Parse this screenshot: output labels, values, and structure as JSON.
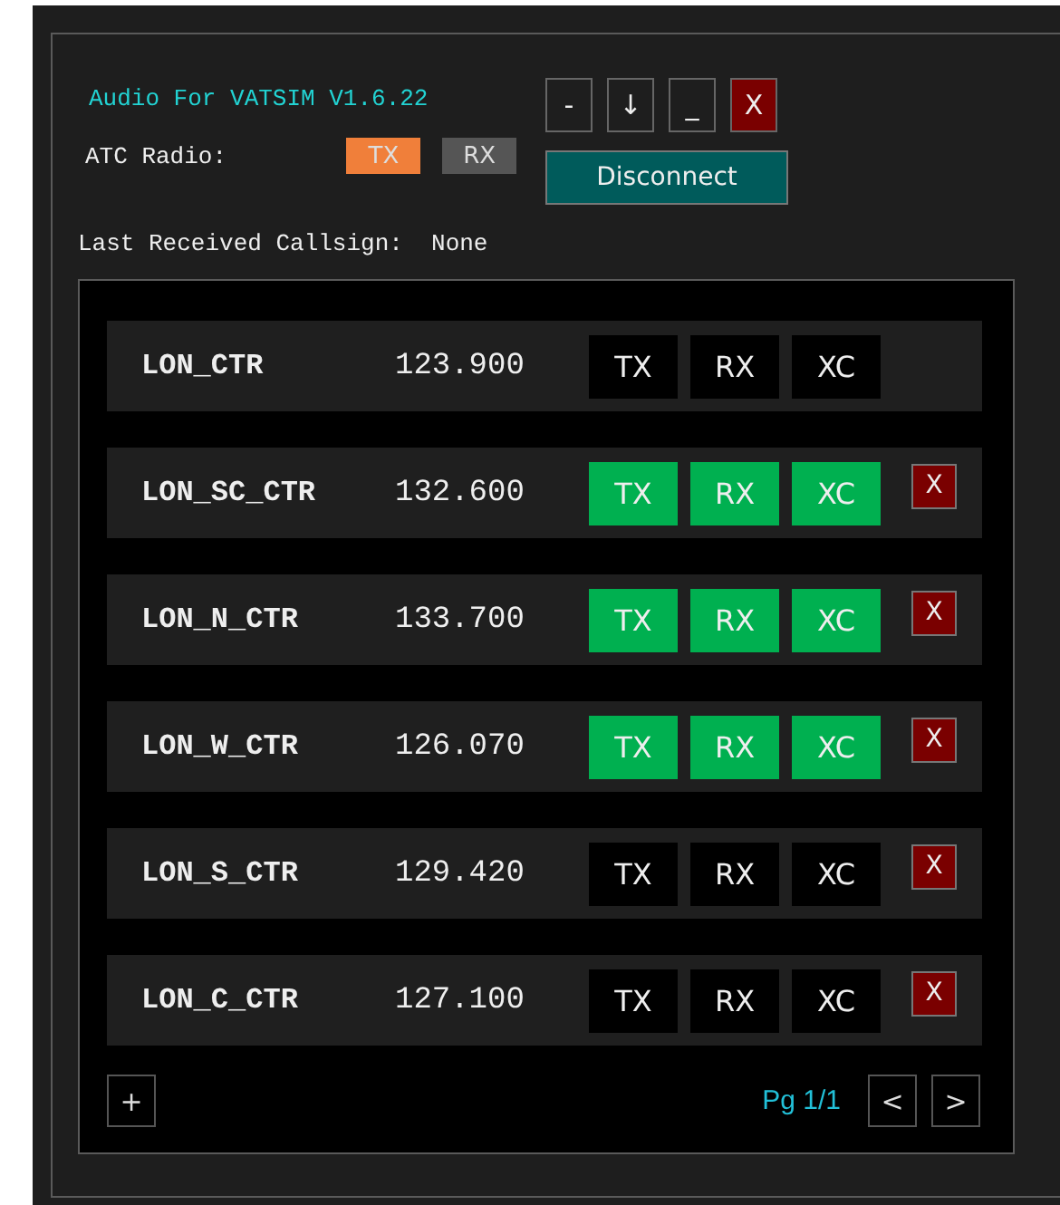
{
  "title": "Audio For VATSIM V1.6.22",
  "window_buttons": [
    {
      "label": "-",
      "kind": "plain"
    },
    {
      "label": "↓",
      "kind": "plain"
    },
    {
      "label": "_",
      "kind": "plain"
    },
    {
      "label": "X",
      "kind": "close"
    }
  ],
  "atc_radio": {
    "label": "ATC Radio:",
    "toggles": [
      {
        "label": "TX",
        "on": true
      },
      {
        "label": "RX",
        "on": false
      }
    ]
  },
  "connect_button": "Disconnect",
  "last_received": {
    "label": "Last Received Callsign:",
    "value": "None"
  },
  "stations": [
    {
      "callsign": "LON_CTR",
      "frequency": "123.900",
      "toggles": [
        {
          "label": "TX",
          "on": false
        },
        {
          "label": "RX",
          "on": false
        },
        {
          "label": "XC",
          "on": false
        }
      ]
    },
    {
      "callsign": "LON_SC_CTR",
      "frequency": "132.600",
      "toggles": [
        {
          "label": "TX",
          "on": true
        },
        {
          "label": "RX",
          "on": true
        },
        {
          "label": "XC",
          "on": true
        }
      ],
      "remove": "X"
    },
    {
      "callsign": "LON_N_CTR",
      "frequency": "133.700",
      "toggles": [
        {
          "label": "TX",
          "on": true
        },
        {
          "label": "RX",
          "on": true
        },
        {
          "label": "XC",
          "on": true
        }
      ],
      "remove": "X"
    },
    {
      "callsign": "LON_W_CTR",
      "frequency": "126.070",
      "toggles": [
        {
          "label": "TX",
          "on": true
        },
        {
          "label": "RX",
          "on": true
        },
        {
          "label": "XC",
          "on": true
        }
      ],
      "remove": "X"
    },
    {
      "callsign": "LON_S_CTR",
      "frequency": "129.420",
      "toggles": [
        {
          "label": "TX",
          "on": false
        },
        {
          "label": "RX",
          "on": false
        },
        {
          "label": "XC",
          "on": false
        }
      ],
      "remove": "X"
    },
    {
      "callsign": "LON_C_CTR",
      "frequency": "127.100",
      "toggles": [
        {
          "label": "TX",
          "on": false
        },
        {
          "label": "RX",
          "on": false
        },
        {
          "label": "XC",
          "on": false
        }
      ],
      "remove": "X"
    }
  ],
  "footer": {
    "add_button": "+",
    "page": "Pg 1/1",
    "prev": "<",
    "next": ">"
  }
}
